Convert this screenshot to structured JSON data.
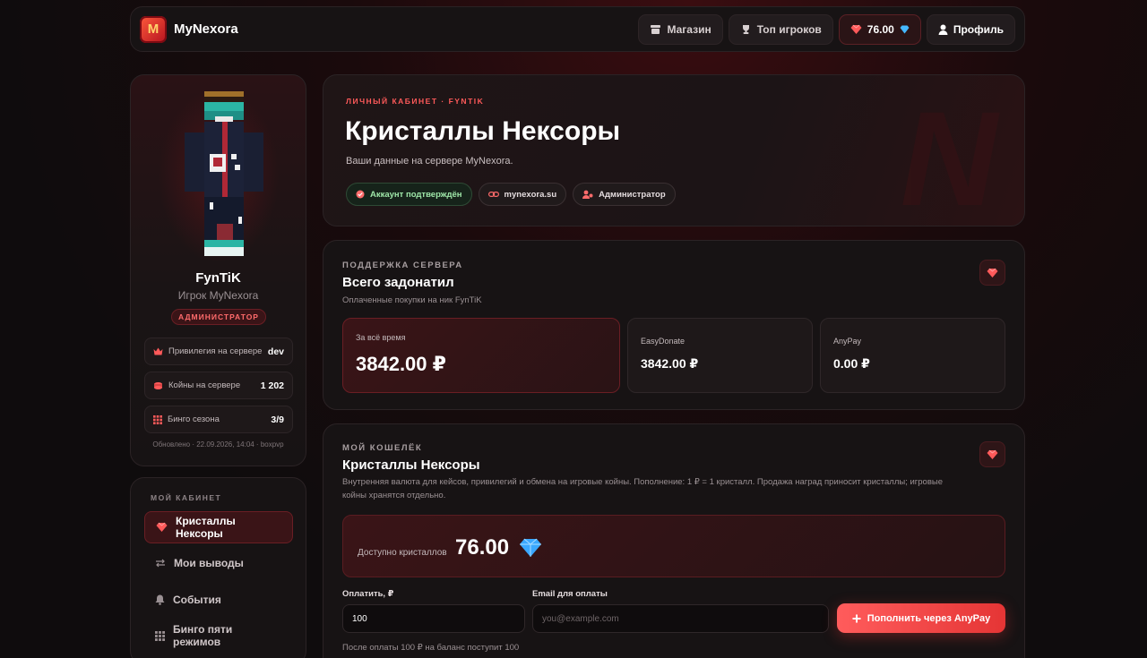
{
  "nav": {
    "brand": "MyNexora",
    "shop": "Магазин",
    "top_players": "Топ игроков",
    "balance": "76.00",
    "profile": "Профиль"
  },
  "sidebar": {
    "username": "FynTiK",
    "subtitle": "Игрок MyNexora",
    "role_badge": "АДМИНИСТРАТОР",
    "stats": [
      {
        "label": "Привилегия на сервере",
        "value": "dev",
        "icon": "crown-icon"
      },
      {
        "label": "Койны на сервере",
        "value": "1 202",
        "icon": "coins-icon"
      },
      {
        "label": "Бинго сезона",
        "value": "3/9",
        "icon": "grid-icon"
      }
    ],
    "updated": "Обновлено · 22.09.2026, 14:04 · boxpvp"
  },
  "menu": {
    "title": "МОЙ КАБИНЕТ",
    "items": [
      {
        "label": "Кристаллы Нексоры",
        "icon": "gem-icon",
        "active": true
      },
      {
        "label": "Мои выводы",
        "icon": "swap-icon",
        "active": false
      },
      {
        "label": "События",
        "icon": "bell-icon",
        "active": false
      },
      {
        "label": "Бинго пяти режимов",
        "icon": "grid-icon",
        "active": false
      }
    ]
  },
  "hero": {
    "kicker": "ЛИЧНЫЙ КАБИНЕТ · FYNTIK",
    "title": "Кристаллы Нексоры",
    "subtitle": "Ваши данные на сервере MyNexora.",
    "watermark": "N",
    "chips": [
      {
        "label": "Аккаунт подтверждён",
        "icon": "check-circle-icon"
      },
      {
        "label": "mynexora.su",
        "icon": "link-icon"
      },
      {
        "label": "Администратор",
        "icon": "user-gear-icon"
      }
    ]
  },
  "donations": {
    "kicker": "ПОДДЕРЖКА СЕРВЕРА",
    "title": "Всего задонатил",
    "desc": "Оплаченные покупки на ник FynTiK",
    "boxes": [
      {
        "label": "За всё время",
        "value": "3842.00 ₽"
      },
      {
        "label": "EasyDonate",
        "value": "3842.00 ₽"
      },
      {
        "label": "AnyPay",
        "value": "0.00 ₽"
      }
    ]
  },
  "wallet": {
    "kicker": "МОЙ КОШЕЛЁК",
    "title": "Кристаллы Нексоры",
    "desc_line1": "Внутренняя валюта для кейсов, привилегий и обмена на игровые койны. Пополнение: 1 ₽ = 1 кристалл. Продажа наград приносит кристаллы; игровые",
    "desc_line2": "койны хранятся отдельно.",
    "balance_label": "Доступно кристаллов",
    "balance_value": "76.00",
    "amount_label": "Оплатить, ₽",
    "amount_value": "100",
    "email_label": "Email для оплаты",
    "email_placeholder": "you@example.com",
    "pay_button": "Пополнить через AnyPay",
    "pay_note": "После оплаты 100 ₽ на баланс поступит 100"
  },
  "colors": {
    "accent": "#ff5a5a",
    "background": "#0f0c0d",
    "card": "#171314",
    "success": "#9ee6a8"
  }
}
